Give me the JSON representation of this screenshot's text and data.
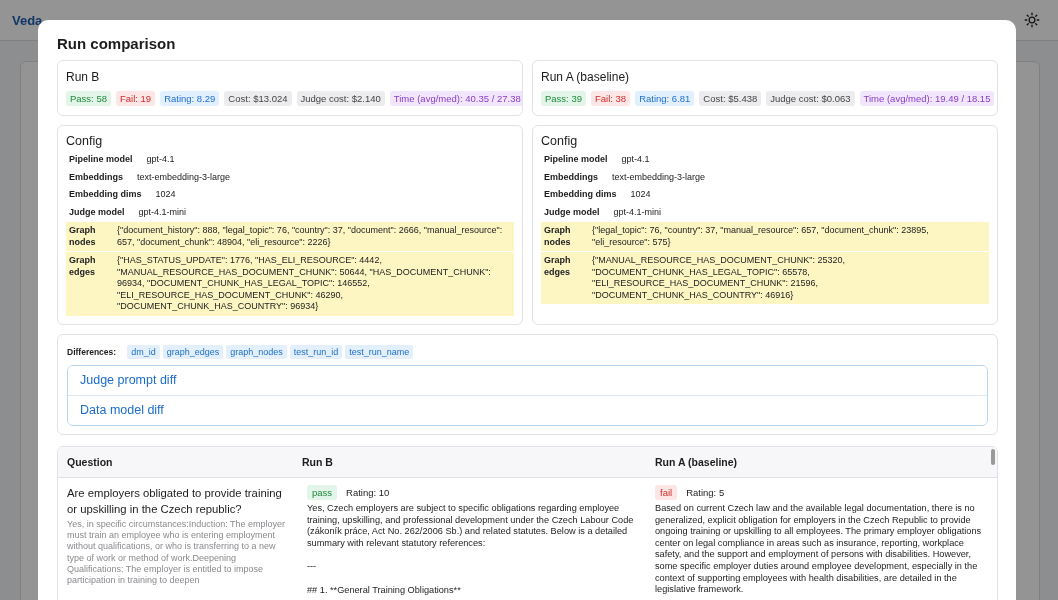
{
  "background": {
    "brand": "Veda"
  },
  "modal": {
    "title": "Run comparison",
    "runs": [
      {
        "name": "Run B",
        "stats": [
          {
            "kind": "pass",
            "text": "Pass: 58"
          },
          {
            "kind": "fail",
            "text": "Fail: 19"
          },
          {
            "kind": "rating",
            "text": "Rating: 8.29"
          },
          {
            "kind": "cost",
            "text": "Cost: $13.024"
          },
          {
            "kind": "cost",
            "text": "Judge cost: $2.140"
          },
          {
            "kind": "time",
            "text": "Time (avg/med): 40.35 / 27.38"
          }
        ]
      },
      {
        "name": "Run A (baseline)",
        "stats": [
          {
            "kind": "pass",
            "text": "Pass: 39"
          },
          {
            "kind": "fail",
            "text": "Fail: 38"
          },
          {
            "kind": "rating",
            "text": "Rating: 6.81"
          },
          {
            "kind": "cost",
            "text": "Cost: $5.438"
          },
          {
            "kind": "cost",
            "text": "Judge cost: $0.063"
          },
          {
            "kind": "time",
            "text": "Time (avg/med): 19.49 / 18.15"
          }
        ]
      }
    ],
    "configs": [
      {
        "title": "Config",
        "rows": [
          {
            "label": "Pipeline model",
            "value": "gpt-4.1",
            "highlighted": false
          },
          {
            "label": "Embeddings",
            "value": "text-embedding-3-large",
            "highlighted": false
          },
          {
            "label": "Embedding dims",
            "value": "1024",
            "highlighted": false
          },
          {
            "label": "Judge model",
            "value": "gpt-4.1-mini",
            "highlighted": false
          },
          {
            "label": "Graph nodes",
            "value": "{\"document_history\": 888, \"legal_topic\": 76, \"country\": 37, \"document\": 2666, \"manual_resource\": 657, \"document_chunk\": 48904, \"eli_resource\": 2226}",
            "highlighted": true
          },
          {
            "label": "Graph edges",
            "value": "{\"HAS_STATUS_UPDATE\": 1776, \"HAS_ELI_RESOURCE\": 4442, \"MANUAL_RESOURCE_HAS_DOCUMENT_CHUNK\": 50644, \"HAS_DOCUMENT_CHUNK\": 96934, \"DOCUMENT_CHUNK_HAS_LEGAL_TOPIC\": 146552, \"ELI_RESOURCE_HAS_DOCUMENT_CHUNK\": 46290, \"DOCUMENT_CHUNK_HAS_COUNTRY\": 96934}",
            "highlighted": true
          }
        ]
      },
      {
        "title": "Config",
        "rows": [
          {
            "label": "Pipeline model",
            "value": "gpt-4.1",
            "highlighted": false
          },
          {
            "label": "Embeddings",
            "value": "text-embedding-3-large",
            "highlighted": false
          },
          {
            "label": "Embedding dims",
            "value": "1024",
            "highlighted": false
          },
          {
            "label": "Judge model",
            "value": "gpt-4.1-mini",
            "highlighted": false
          },
          {
            "label": "Graph nodes",
            "value": "{\"legal_topic\": 76, \"country\": 37, \"manual_resource\": 657, \"document_chunk\": 23895, \"eli_resource\": 575}",
            "highlighted": true
          },
          {
            "label": "Graph edges",
            "value": "{\"MANUAL_RESOURCE_HAS_DOCUMENT_CHUNK\": 25320, \"DOCUMENT_CHUNK_HAS_LEGAL_TOPIC\": 65578, \"ELI_RESOURCE_HAS_DOCUMENT_CHUNK\": 21596, \"DOCUMENT_CHUNK_HAS_COUNTRY\": 46916}",
            "highlighted": true
          }
        ]
      }
    ],
    "differences": {
      "label": "Differences:",
      "tags": [
        "dm_id",
        "graph_edges",
        "graph_nodes",
        "test_run_id",
        "test_run_name"
      ]
    },
    "diff_links": [
      "Judge prompt diff",
      "Data model diff"
    ],
    "table": {
      "columns": [
        "Question",
        "Run B",
        "Run A (baseline)"
      ],
      "rows": [
        {
          "question": "Are employers obligated to provide training or upskilling in the Czech republic?",
          "reference": "Yes, in specific circumstances:Induction: The employer must train an employee who is entering employment without qualifications, or who is transferring to a new type of work or method of work.Deepening Qualifications: The employer is entitled to impose participation in training to deepen",
          "results": [
            {
              "verdict": "pass",
              "rating": "Rating: 10",
              "answer": [
                "Yes, Czech employers are subject to specific obligations regarding employee training, upskilling, and professional development under the Czech Labour Code (zákoník práce, Act No. 262/2006 Sb.) and related statutes. Below is a detailed summary with relevant statutory references:",
                "---",
                "## 1. **General Training Obligations**"
              ]
            },
            {
              "verdict": "fail",
              "rating": "Rating: 5",
              "answer": [
                "Based on current Czech law and the available legal documentation, there is no generalized, explicit obligation for employers in the Czech Republic to provide ongoing training or upskilling to all employees. The primary employer obligations center on legal compliance in areas such as insurance, reporting, workplace safety, and the support and employment of persons with disabilities. However, some specific employer duties around employee development, especially in the context of supporting employees with health disabilities, are detailed in the legislative framework."
              ]
            }
          ]
        }
      ]
    }
  }
}
